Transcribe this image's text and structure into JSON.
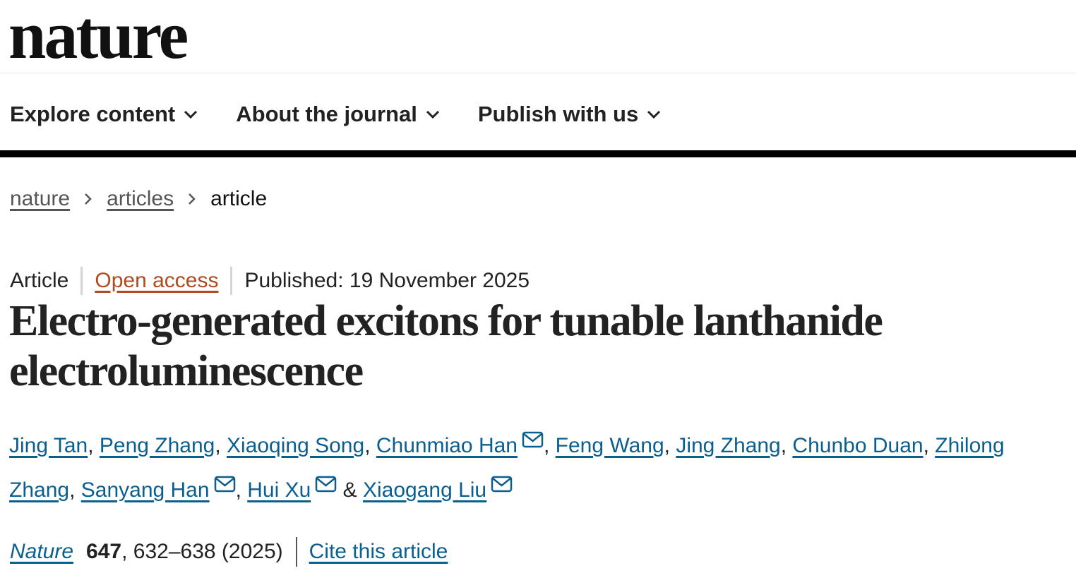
{
  "header": {
    "logo": "nature"
  },
  "nav": {
    "items": [
      {
        "label": "Explore content",
        "icon": "chevron-down-icon"
      },
      {
        "label": "About the journal",
        "icon": "chevron-down-icon"
      },
      {
        "label": "Publish with us",
        "icon": "chevron-down-icon"
      }
    ]
  },
  "breadcrumb": {
    "items": [
      "nature",
      "articles"
    ],
    "current": "article"
  },
  "meta": {
    "type": "Article",
    "access": "Open access",
    "published": "Published: 19 November 2025"
  },
  "title": {
    "line1": "Electro-generated excitons for tunable lanthanide",
    "line2": "electroluminescence"
  },
  "authors": [
    {
      "name": "Jing Tan",
      "sep": ", ",
      "email": false
    },
    {
      "name": "Peng Zhang",
      "sep": ", ",
      "email": false
    },
    {
      "name": "Xiaoqing Song",
      "sep": ", ",
      "email": false
    },
    {
      "name": "Chunmiao Han",
      "sep": ", ",
      "email": true
    },
    {
      "name": "Feng Wang",
      "sep": ", ",
      "email": false
    },
    {
      "name": "Jing Zhang",
      "sep": ", ",
      "email": false
    },
    {
      "name": "Chunbo Duan",
      "sep": ", ",
      "email": false
    },
    {
      "name": "Zhilong Zhang",
      "sep": ", ",
      "email": false
    },
    {
      "name": "Sanyang Han",
      "sep": ", ",
      "email": true
    },
    {
      "name": "Hui Xu",
      "sep": " & ",
      "email": true
    },
    {
      "name": "Xiaogang Liu",
      "sep": "",
      "email": true
    }
  ],
  "citation": {
    "journal": "Nature",
    "volume": "647",
    "pages": ", 632–638 (2025)",
    "cite_label": "Cite this article"
  },
  "colors": {
    "link": "#0b5f8f",
    "open_access": "#b14a1d",
    "nav_rule": "#000000"
  }
}
